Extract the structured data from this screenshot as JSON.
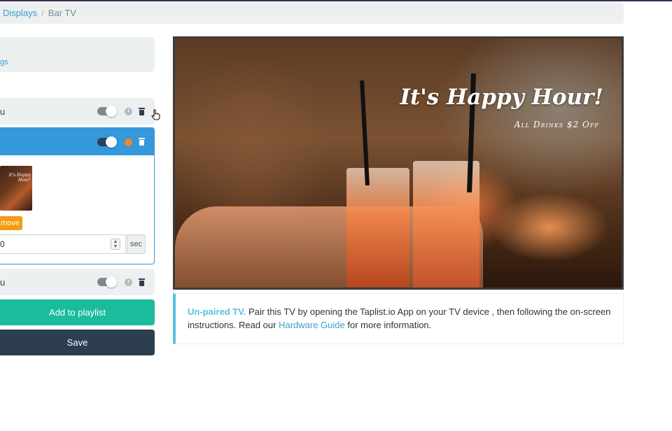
{
  "breadcrumb": {
    "parent": "Displays",
    "separator": "/",
    "current": "Bar TV"
  },
  "settings": {
    "link_fragment": "gs"
  },
  "playlist": {
    "items": [
      {
        "name_fragment": "u",
        "enabled": true
      },
      {
        "name_fragment": "",
        "enabled": true,
        "expanded": true
      },
      {
        "name_fragment": "u",
        "enabled": true
      }
    ],
    "expanded_item": {
      "thumbnail_text": "It's Happy Hour!",
      "remove_label": "move",
      "duration_value": "0",
      "duration_unit": "sec"
    },
    "add_label": "Add to playlist",
    "save_label": "Save"
  },
  "preview": {
    "headline": "It's Happy Hour!",
    "subline": "All Drinks $2 Off"
  },
  "notice": {
    "strong": "Un-paired TV.",
    "text_before_link": " Pair this TV by opening the Taplist.io App on your TV device , then following the on-screen instructions. Read our ",
    "link": "Hardware Guide",
    "text_after_link": " for more information."
  },
  "colors": {
    "accent_blue": "#3498db",
    "teal": "#1abc9c",
    "navy": "#2c3e50",
    "orange": "#f39c12",
    "info_blue": "#5bc0de"
  }
}
